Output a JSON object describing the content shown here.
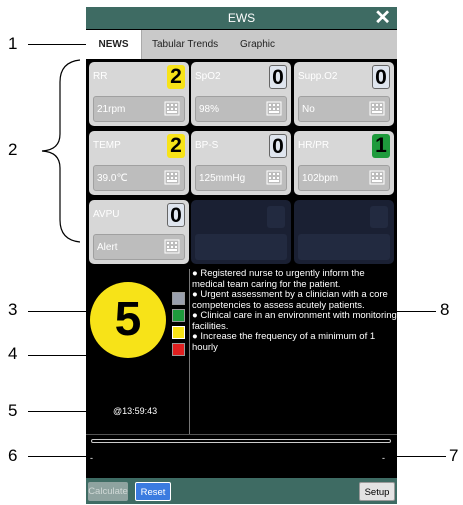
{
  "window": {
    "title": "EWS"
  },
  "tabs": [
    {
      "label": "NEWS",
      "active": true
    },
    {
      "label": "Tabular Trends",
      "active": false
    },
    {
      "label": "Graphic",
      "active": false
    }
  ],
  "parameters": [
    {
      "label": "RR",
      "score": "2",
      "value": "21rpm",
      "score_color": "yellow"
    },
    {
      "label": "SpO2",
      "score": "0",
      "value": "98%",
      "score_color": "gray"
    },
    {
      "label": "Supp.O2",
      "score": "0",
      "value": "No",
      "score_color": "gray"
    },
    {
      "label": "TEMP",
      "score": "2",
      "value": "39.0℃",
      "score_color": "yellow"
    },
    {
      "label": "BP-S",
      "score": "0",
      "value": "125mmHg",
      "score_color": "gray"
    },
    {
      "label": "HR/PR",
      "score": "1",
      "value": "102bpm",
      "score_color": "green"
    },
    {
      "label": "AVPU",
      "score": "0",
      "value": "Alert",
      "score_color": "gray"
    }
  ],
  "total_score": "5",
  "level_colors": [
    "#9aa0ad",
    "#1e9a3c",
    "#f7e318",
    "#e02020"
  ],
  "advice": [
    "● Registered nurse to urgently inform the medical team caring for the patient.",
    "● Urgent assessment by a clinician with a core competencies to assess acutely patients.",
    "● Clinical care in an environment with monitoring facilities.",
    "● Increase the frequency of a minimum of 1 hourly"
  ],
  "timestamp": "@13:59:43",
  "trend": {
    "left": "-",
    "right": "-"
  },
  "buttons": {
    "calculate": "Calculate",
    "reset": "Reset",
    "setup": "Setup"
  },
  "callouts": [
    "1",
    "2",
    "3",
    "4",
    "5",
    "6",
    "7",
    "8"
  ],
  "colors": {
    "title_bar": "#3e6b63",
    "score_yellow": "#f7e318",
    "score_green": "#1e9a3c",
    "reset_blue": "#3b7be0"
  }
}
